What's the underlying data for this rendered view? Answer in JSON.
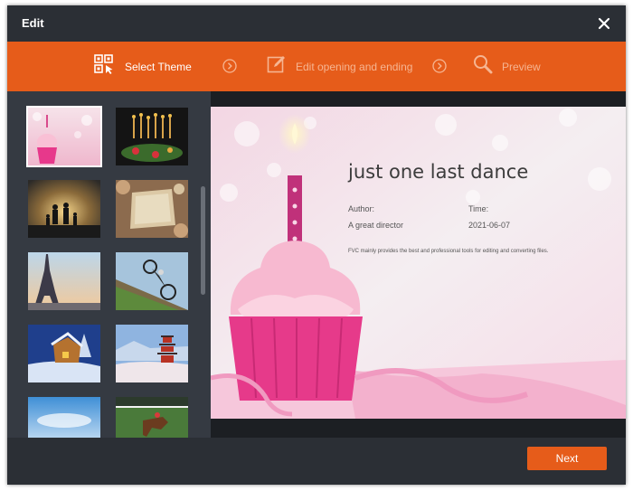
{
  "window": {
    "title": "Edit"
  },
  "steps": [
    {
      "label": "Select Theme",
      "icon": "select-theme-icon"
    },
    {
      "label": "Edit opening and ending",
      "icon": "edit-icon"
    },
    {
      "label": "Preview",
      "icon": "magnifier-icon"
    }
  ],
  "themes": [
    "cupcake-theme",
    "birthday-candles-theme",
    "sunset-family-theme",
    "vintage-frame-theme",
    "eiffel-tower-theme",
    "motocross-theme",
    "winter-cabin-theme",
    "pagoda-theme",
    "sky-theme",
    "horse-racing-theme"
  ],
  "preview": {
    "title": "just one last dance",
    "author_label": "Author:",
    "author_value": "A great director",
    "time_label": "Time:",
    "time_value": "2021-06-07",
    "description": "FVC mainly provides the best and professional tools for editing and converting files."
  },
  "footer": {
    "next_label": "Next"
  },
  "colors": {
    "accent": "#e65c1a",
    "window_bg": "#2b2f35",
    "panel_bg": "#353a42"
  }
}
